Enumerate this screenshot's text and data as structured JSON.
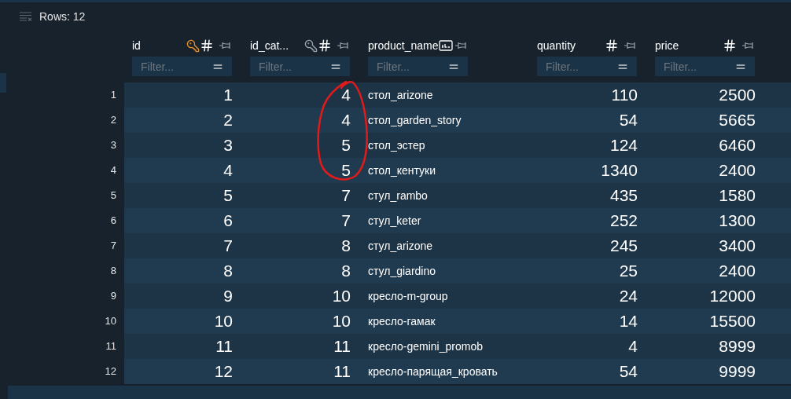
{
  "toolbar": {
    "row_count": "Rows: 12"
  },
  "columns": [
    {
      "label": "id",
      "kind": "primary",
      "filter_placeholder": "Filter..."
    },
    {
      "label": "id_cat...",
      "kind": "foreign",
      "filter_placeholder": "Filter..."
    },
    {
      "label": "product_name",
      "kind": "text",
      "filter_placeholder": "Filter..."
    },
    {
      "label": "quantity",
      "kind": "number",
      "filter_placeholder": "Filter..."
    },
    {
      "label": "price",
      "kind": "number",
      "filter_placeholder": "Filter..."
    }
  ],
  "rows": [
    {
      "number": "1",
      "cells": [
        "1",
        "4",
        "стол_arizone",
        "110",
        "2500"
      ]
    },
    {
      "number": "2",
      "cells": [
        "2",
        "4",
        "стол_garden_story",
        "54",
        "5665"
      ]
    },
    {
      "number": "3",
      "cells": [
        "3",
        "5",
        "стол_эстер",
        "124",
        "6460"
      ]
    },
    {
      "number": "4",
      "cells": [
        "4",
        "5",
        "стол_кентуки",
        "1340",
        "2400"
      ]
    },
    {
      "number": "5",
      "cells": [
        "5",
        "7",
        "стул_rambo",
        "435",
        "1580"
      ]
    },
    {
      "number": "6",
      "cells": [
        "6",
        "7",
        "стул_keter",
        "252",
        "1300"
      ]
    },
    {
      "number": "7",
      "cells": [
        "7",
        "8",
        "стул_arizone",
        "245",
        "3400"
      ]
    },
    {
      "number": "8",
      "cells": [
        "8",
        "8",
        "стул_giardino",
        "25",
        "2400"
      ]
    },
    {
      "number": "9",
      "cells": [
        "9",
        "10",
        "кресло-m-group",
        "24",
        "12000"
      ]
    },
    {
      "number": "10",
      "cells": [
        "10",
        "10",
        "кресло-гамак",
        "14",
        "15500"
      ]
    },
    {
      "number": "11",
      "cells": [
        "11",
        "11",
        "кресло-gemini_promob",
        "4",
        "8999"
      ]
    },
    {
      "number": "12",
      "cells": [
        "12",
        "11",
        "кресло-парящая_кровать",
        "54",
        "9999"
      ]
    }
  ]
}
